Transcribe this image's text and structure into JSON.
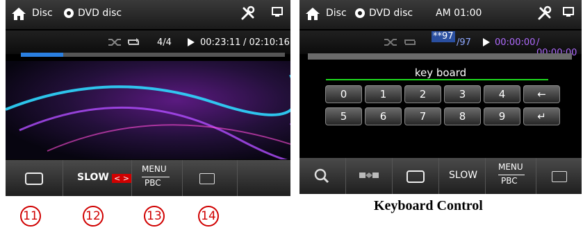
{
  "left": {
    "header": {
      "source_label": "Disc",
      "disc_label": "DVD disc"
    },
    "info": {
      "track": "4/4",
      "elapsed": "00:23:11",
      "total": "/ 02:10:16"
    },
    "progress_fraction": 0.16,
    "bottom": {
      "slow_label": "SLOW",
      "arrows": "< >",
      "menu_label": "MENU",
      "pbc_label": "PBC"
    },
    "callouts": [
      "11",
      "12",
      "13",
      "14"
    ]
  },
  "right": {
    "header": {
      "source_label": "Disc",
      "disc_label": "DVD disc",
      "clock": "AM 01:00"
    },
    "info": {
      "track_input": "**97",
      "track_total": "/97",
      "elapsed": "00:00:00",
      "total": "/ 00:00:00"
    },
    "keyboard": {
      "title": "key board",
      "row1": [
        "0",
        "1",
        "2",
        "3",
        "4"
      ],
      "row2": [
        "5",
        "6",
        "7",
        "8",
        "9"
      ],
      "backspace": "←",
      "enter": "↵"
    },
    "bottom": {
      "slow_label": "SLOW",
      "menu_label": "MENU",
      "pbc_label": "PBC"
    }
  },
  "caption": "Keyboard Control",
  "colors": {
    "accent_red": "#d00000",
    "progress_blue": "#2a7fe0",
    "keyboard_line": "#1fdc1f"
  }
}
